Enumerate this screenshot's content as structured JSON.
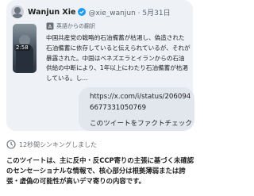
{
  "tweet": {
    "author": "Wanjun Xie",
    "handle": "@xie_wanjun",
    "date": "5月31日",
    "video_duration": "2:58",
    "translate_label": "英語からの翻訳",
    "text": "中国共産党の戦略的石油備蓄が枯渇し、偽造された石油備蓄に依存していると伝えられているが、それが暴露された。中国はベネズエラとイランからの石油供給の中断により、1年以上にわたり石油備蓄が枯渇している。し..."
  },
  "user_prompt": {
    "url": "https://x.com/i/status/2060946677331050769",
    "action": "このツイートをファクトチェック"
  },
  "status": {
    "sync_text": "12秒間シンキングしました"
  },
  "answer": {
    "text": "このツイートは、主に反中・反CCP寄りの主張に基づく未確認のセンセーショナルな情報で、核心部分は根拠薄弱または誇張・虚偽の可能性が高いデマ寄りの内容です。"
  },
  "colors": {
    "card_bg": "#eef1f6",
    "chip_bg": "#e2e6ed",
    "verified": "#1d9bf0"
  }
}
